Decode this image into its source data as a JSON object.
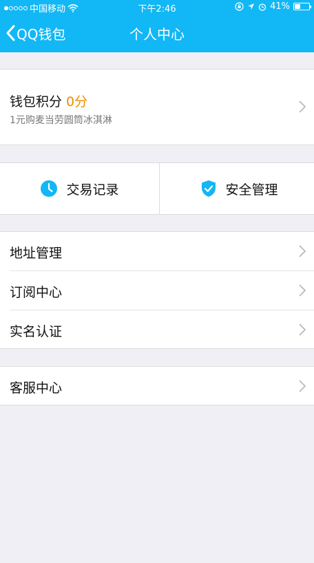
{
  "status": {
    "carrier": "中国移动",
    "time": "下午2:46",
    "battery_text": "41%",
    "battery_level": 0.41
  },
  "nav": {
    "back_label": "QQ钱包",
    "title": "个人中心"
  },
  "points": {
    "title": "钱包积分",
    "value": "0分",
    "subtitle": "1元购麦当劳圆筒冰淇淋"
  },
  "actions": [
    {
      "label": "交易记录",
      "icon": "clock-icon"
    },
    {
      "label": "安全管理",
      "icon": "shield-icon"
    }
  ],
  "menu": [
    {
      "label": "地址管理"
    },
    {
      "label": "订阅中心"
    },
    {
      "label": "实名认证"
    }
  ],
  "menu2": [
    {
      "label": "客服中心"
    }
  ],
  "colors": {
    "header": "#12b7f5",
    "accent_orange": "#f08c00",
    "background": "#f0eff5"
  }
}
